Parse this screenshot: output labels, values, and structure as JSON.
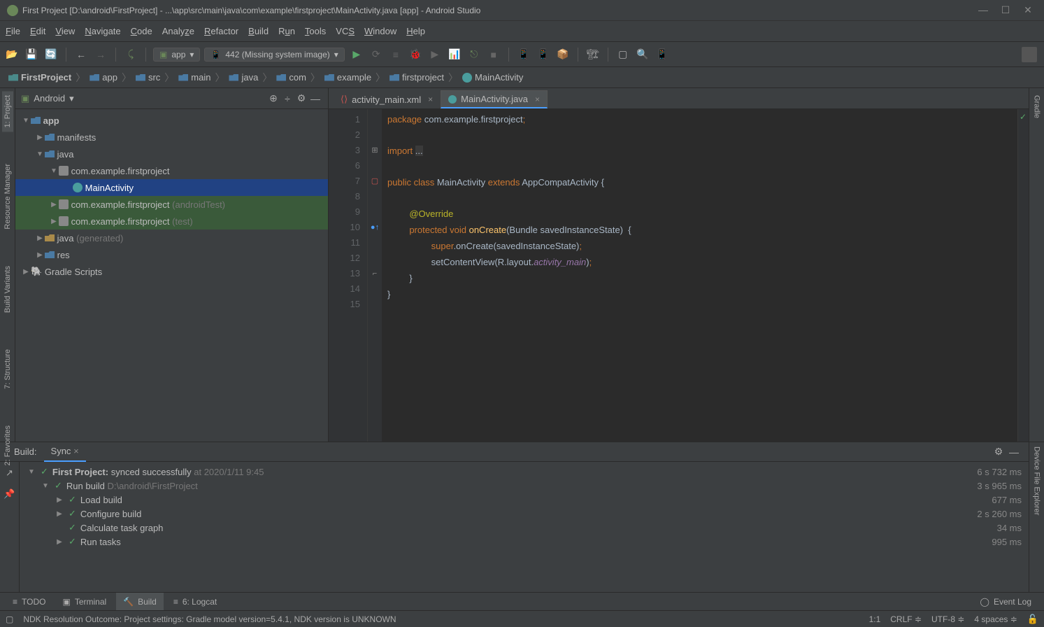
{
  "title": "First Project [D:\\android\\FirstProject] - ...\\app\\src\\main\\java\\com\\example\\firstproject\\MainActivity.java [app] - Android Studio",
  "menu": [
    "File",
    "Edit",
    "View",
    "Navigate",
    "Code",
    "Analyze",
    "Refactor",
    "Build",
    "Run",
    "Tools",
    "VCS",
    "Window",
    "Help"
  ],
  "runconfig": "app",
  "device": "442 (Missing system image)",
  "breadcrumb": [
    "FirstProject",
    "app",
    "src",
    "main",
    "java",
    "com",
    "example",
    "firstproject",
    "MainActivity"
  ],
  "projecttab": "Android",
  "leftgutter": [
    "1: Project",
    "Resource Manager",
    "Build Variants",
    "7: Structure",
    "2: Favorites"
  ],
  "rightgutter_top": "Gradle",
  "rightgutter_bottom": "Device File Explorer",
  "tree": {
    "app": "app",
    "manifests": "manifests",
    "java": "java",
    "pkg1": "com.example.firstproject",
    "main": "MainActivity",
    "pkg2": "com.example.firstproject",
    "pkg2s": "(androidTest)",
    "pkg3": "com.example.firstproject",
    "pkg3s": "(test)",
    "javagen": "java",
    "javagens": "(generated)",
    "res": "res",
    "gradle": "Gradle Scripts"
  },
  "tabs": [
    {
      "label": "activity_main.xml",
      "active": false
    },
    {
      "label": "MainActivity.java",
      "active": true
    }
  ],
  "lines": [
    "1",
    "2",
    "3",
    "6",
    "7",
    "8",
    "9",
    "10",
    "11",
    "12",
    "13",
    "14",
    "15"
  ],
  "code": {
    "l1a": "package",
    "l1b": " com.example.firstproject",
    "l1c": ";",
    "l3a": "import ",
    "l3b": "...",
    "l7a": "public class ",
    "l7b": "MainActivity ",
    "l7c": "extends ",
    "l7d": "AppCompatActivity {",
    "l9": "@Override",
    "l10a": "protected void ",
    "l10b": "onCreate",
    "l10c": "(Bundle savedInstanceState)  {",
    "l11a": "super",
    "l11b": ".onCreate(savedInstanceState)",
    "l11c": ";",
    "l12a": "setContentView(R.layout.",
    "l12b": "activity_main",
    "l12c": ")",
    "l12d": ";",
    "l13": "}",
    "l14": "}"
  },
  "build": {
    "tab1": "Build:",
    "tab2": "Sync",
    "r1": "First Project:",
    "r1b": "synced successfully",
    "r1c": "at 2020/1/11 9:45",
    "t1": "6 s 732 ms",
    "r2": "Run build",
    "r2b": "D:\\android\\FirstProject",
    "t2": "3 s 965 ms",
    "r3": "Load build",
    "t3": "677 ms",
    "r4": "Configure build",
    "t4": "2 s 260 ms",
    "r5": "Calculate task graph",
    "t5": "34 ms",
    "r6": "Run tasks",
    "t6": "995 ms"
  },
  "tools": [
    "TODO",
    "Terminal",
    "Build",
    "6: Logcat"
  ],
  "eventlog": "Event Log",
  "status": {
    "msg": "NDK Resolution Outcome: Project settings: Gradle model version=5.4.1, NDK version is UNKNOWN",
    "pos": "1:1",
    "le": "CRLF",
    "enc": "UTF-8",
    "indent": "4 spaces"
  }
}
